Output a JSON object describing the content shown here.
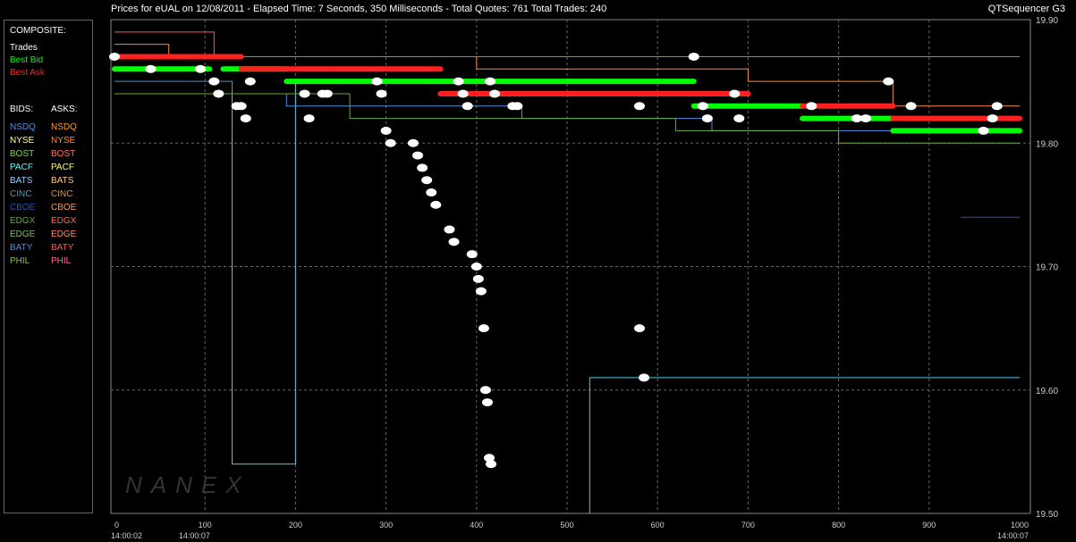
{
  "header": {
    "title": "Prices for  eUAL  on  12/08/2011  -  Elapsed Time: 7 Seconds, 350 Milliseconds  -  Total Quotes: 761  Total Trades: 240",
    "app": "QTSequencer G3"
  },
  "legend": {
    "composite_header": "COMPOSITE:",
    "composite": [
      {
        "label": "Trades",
        "color": "#ffffff"
      },
      {
        "label": "Best Bid",
        "color": "#00ff00"
      },
      {
        "label": "Best Ask",
        "color": "#ff2020"
      }
    ],
    "bids_header": "BIDS:",
    "asks_header": "ASKS:",
    "exchanges": [
      {
        "bid": "NSDQ",
        "ask": "NSDQ",
        "bid_color": "#4f8fdf",
        "ask_color": "#ff9933"
      },
      {
        "bid": "NYSE",
        "ask": "NYSE",
        "bid_color": "#ffff99",
        "ask_color": "#ff8844"
      },
      {
        "bid": "BOST",
        "ask": "BOST",
        "bid_color": "#88cc66",
        "ask_color": "#ff7766"
      },
      {
        "bid": "PACF",
        "ask": "PACF",
        "bid_color": "#55ffff",
        "ask_color": "#ffff66"
      },
      {
        "bid": "BATS",
        "ask": "BATS",
        "bid_color": "#99ccff",
        "ask_color": "#ffcc88"
      },
      {
        "bid": "CINC",
        "ask": "CINC",
        "bid_color": "#5599bb",
        "ask_color": "#dd9944"
      },
      {
        "bid": "CBOE",
        "ask": "CBOE",
        "bid_color": "#2255bb",
        "ask_color": "#ff9955"
      },
      {
        "bid": "EDGX",
        "ask": "EDGX",
        "bid_color": "#66aa44",
        "ask_color": "#ff6655"
      },
      {
        "bid": "EDGE",
        "ask": "EDGE",
        "bid_color": "#88bb66",
        "ask_color": "#ff8866"
      },
      {
        "bid": "BATY",
        "ask": "BATY",
        "bid_color": "#5588dd",
        "ask_color": "#ff5555"
      },
      {
        "bid": "PHIL",
        "ask": "PHIL",
        "bid_color": "#99bb55",
        "ask_color": "#ff6699"
      }
    ]
  },
  "watermark": "NANEX",
  "chart_data": {
    "type": "scatter",
    "xlim": [
      0,
      1000
    ],
    "ylim": [
      19.5,
      19.9
    ],
    "x_ticks": [
      0,
      100,
      200,
      300,
      400,
      500,
      600,
      700,
      800,
      900,
      1000
    ],
    "y_ticks": [
      19.5,
      19.6,
      19.7,
      19.8,
      19.9
    ],
    "y_tick_labels": [
      "19.50",
      "19.60",
      "19.70",
      "19.80",
      "19.90"
    ],
    "time_labels": [
      {
        "x": 0,
        "label": "14:00:02"
      },
      {
        "x": 75,
        "label": "14:00:07"
      },
      {
        "x": 1000,
        "label": "14:00:07"
      }
    ],
    "grid": true,
    "series": [
      {
        "name": "Trades",
        "color": "#ffffff",
        "points": [
          [
            0,
            19.87
          ],
          [
            40,
            19.86
          ],
          [
            95,
            19.86
          ],
          [
            110,
            19.85
          ],
          [
            115,
            19.84
          ],
          [
            150,
            19.85
          ],
          [
            135,
            19.83
          ],
          [
            140,
            19.83
          ],
          [
            145,
            19.82
          ],
          [
            210,
            19.84
          ],
          [
            215,
            19.82
          ],
          [
            230,
            19.84
          ],
          [
            235,
            19.84
          ],
          [
            290,
            19.85
          ],
          [
            295,
            19.84
          ],
          [
            300,
            19.81
          ],
          [
            305,
            19.8
          ],
          [
            330,
            19.8
          ],
          [
            335,
            19.79
          ],
          [
            340,
            19.78
          ],
          [
            345,
            19.77
          ],
          [
            350,
            19.76
          ],
          [
            355,
            19.75
          ],
          [
            370,
            19.73
          ],
          [
            375,
            19.72
          ],
          [
            395,
            19.71
          ],
          [
            400,
            19.7
          ],
          [
            402,
            19.69
          ],
          [
            405,
            19.68
          ],
          [
            408,
            19.65
          ],
          [
            410,
            19.6
          ],
          [
            412,
            19.59
          ],
          [
            414,
            19.545
          ],
          [
            416,
            19.54
          ],
          [
            380,
            19.85
          ],
          [
            385,
            19.84
          ],
          [
            390,
            19.83
          ],
          [
            415,
            19.85
          ],
          [
            420,
            19.84
          ],
          [
            440,
            19.83
          ],
          [
            445,
            19.83
          ],
          [
            580,
            19.65
          ],
          [
            585,
            19.61
          ],
          [
            580,
            19.83
          ],
          [
            640,
            19.87
          ],
          [
            650,
            19.83
          ],
          [
            655,
            19.82
          ],
          [
            685,
            19.84
          ],
          [
            690,
            19.82
          ],
          [
            770,
            19.83
          ],
          [
            820,
            19.82
          ],
          [
            830,
            19.82
          ],
          [
            855,
            19.85
          ],
          [
            880,
            19.83
          ],
          [
            960,
            19.81
          ],
          [
            970,
            19.82
          ],
          [
            975,
            19.83
          ]
        ]
      },
      {
        "name": "Best Bid",
        "color": "#00ff00",
        "segments": [
          [
            0,
            105,
            19.86
          ],
          [
            120,
            190,
            19.86
          ],
          [
            190,
            245,
            19.85
          ],
          [
            245,
            310,
            19.85
          ],
          [
            310,
            400,
            19.85
          ],
          [
            400,
            440,
            19.85
          ],
          [
            440,
            520,
            19.85
          ],
          [
            520,
            600,
            19.85
          ],
          [
            600,
            640,
            19.85
          ],
          [
            640,
            700,
            19.83
          ],
          [
            700,
            760,
            19.83
          ],
          [
            760,
            780,
            19.82
          ],
          [
            780,
            860,
            19.82
          ],
          [
            860,
            1000,
            19.81
          ]
        ]
      },
      {
        "name": "Best Ask",
        "color": "#ff2020",
        "segments": [
          [
            0,
            95,
            19.87
          ],
          [
            95,
            140,
            19.87
          ],
          [
            140,
            200,
            19.86
          ],
          [
            200,
            240,
            19.86
          ],
          [
            240,
            300,
            19.86
          ],
          [
            300,
            360,
            19.86
          ],
          [
            360,
            500,
            19.84
          ],
          [
            500,
            560,
            19.84
          ],
          [
            560,
            640,
            19.84
          ],
          [
            640,
            700,
            19.84
          ],
          [
            760,
            820,
            19.83
          ],
          [
            820,
            860,
            19.83
          ],
          [
            860,
            1000,
            19.82
          ]
        ]
      }
    ],
    "quote_lines": [
      {
        "name": "PACF",
        "color": "#55ccdd",
        "points": [
          [
            130,
            19.85
          ],
          [
            130,
            19.54
          ],
          [
            200,
            19.54
          ],
          [
            200,
            19.85
          ]
        ]
      },
      {
        "name": "PACF",
        "color": "#55ccdd",
        "points": [
          [
            525,
            19.5
          ],
          [
            525,
            19.61
          ],
          [
            1000,
            19.61
          ]
        ]
      },
      {
        "name": "CBOE",
        "color": "#2255bb",
        "points": [
          [
            935,
            19.74
          ],
          [
            1000,
            19.74
          ]
        ]
      },
      {
        "name": "NSDQ",
        "color": "#4f8fdf",
        "points": [
          [
            0,
            19.85
          ],
          [
            130,
            19.85
          ],
          [
            130,
            19.84
          ],
          [
            190,
            19.84
          ],
          [
            190,
            19.83
          ],
          [
            450,
            19.83
          ],
          [
            450,
            19.82
          ],
          [
            660,
            19.82
          ],
          [
            660,
            19.81
          ],
          [
            860,
            19.81
          ],
          [
            1000,
            19.81
          ]
        ]
      },
      {
        "name": "EDGX",
        "color": "#66aa44",
        "points": [
          [
            0,
            19.84
          ],
          [
            260,
            19.84
          ],
          [
            260,
            19.82
          ],
          [
            620,
            19.82
          ],
          [
            620,
            19.81
          ],
          [
            800,
            19.81
          ],
          [
            800,
            19.8
          ],
          [
            1000,
            19.8
          ]
        ]
      },
      {
        "name": "NYSE",
        "color": "#ff8844",
        "points": [
          [
            0,
            19.88
          ],
          [
            60,
            19.88
          ],
          [
            60,
            19.87
          ],
          [
            400,
            19.87
          ],
          [
            400,
            19.86
          ],
          [
            700,
            19.86
          ],
          [
            700,
            19.85
          ],
          [
            860,
            19.85
          ],
          [
            860,
            19.83
          ],
          [
            1000,
            19.83
          ]
        ]
      },
      {
        "name": "BATY",
        "color": "#ff5555",
        "points": [
          [
            0,
            19.89
          ],
          [
            110,
            19.89
          ],
          [
            110,
            19.87
          ],
          [
            1000,
            19.87
          ]
        ]
      }
    ]
  }
}
